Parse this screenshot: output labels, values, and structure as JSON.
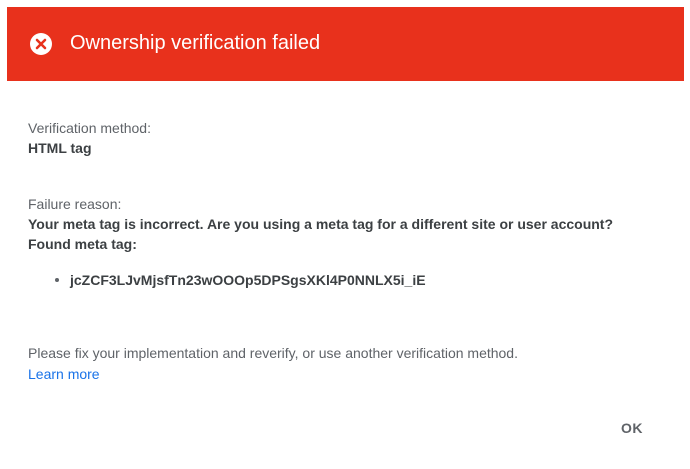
{
  "colors": {
    "header_background": "#e8311c",
    "link": "#1a73e8"
  },
  "header": {
    "icon": "error-circle-x-icon",
    "title": "Ownership verification failed"
  },
  "verification": {
    "method_label": "Verification method:",
    "method_value": "HTML tag"
  },
  "failure": {
    "reason_label": "Failure reason:",
    "reason_text": "Your meta tag is incorrect. Are you using a meta tag for a different site or user account?",
    "found_label": "Found meta tag:",
    "found_tags": [
      "jcZCF3LJvMjsfTn23wOOOp5DPSgsXKl4P0NNLX5i_iE"
    ]
  },
  "footer": {
    "instructions": "Please fix your implementation and reverify, or use another verification method.",
    "learn_more": "Learn more",
    "ok_label": "OK"
  }
}
